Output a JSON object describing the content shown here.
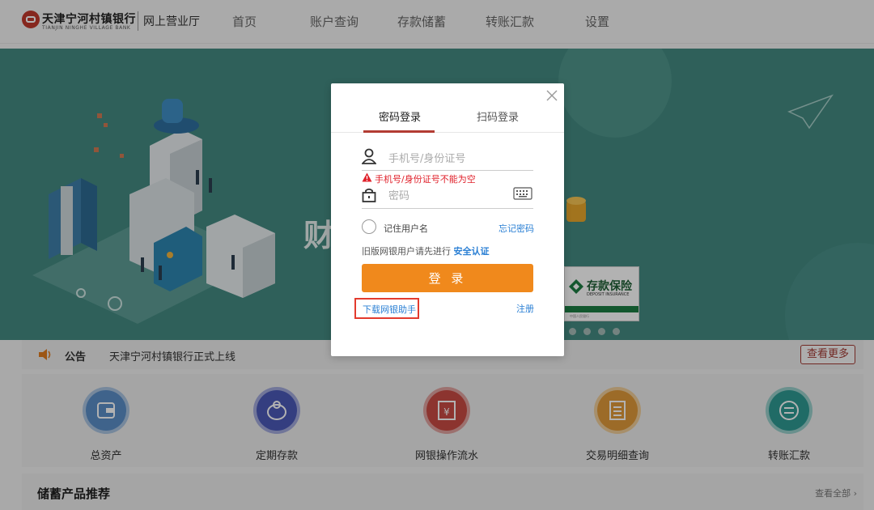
{
  "header": {
    "bank_name": "天津宁河村镇银行",
    "bank_name_en": "TIANJIN NINGHE VILLAGE BANK",
    "subtitle": "网上营业厅",
    "nav": [
      "首页",
      "账户查询",
      "存款储蓄",
      "转账汇款",
      "设置"
    ]
  },
  "banner": {
    "partial_text": "财",
    "insurance_badge": {
      "title": "存款保险",
      "subtitle": "DEPOSIT INSURANCE",
      "fine_print": "中国人民银行"
    },
    "carousel_dots": 4
  },
  "notice": {
    "label": "公告",
    "text": "天津宁河村镇银行正式上线",
    "more_button": "查看更多"
  },
  "services": [
    {
      "label": "总资产",
      "icon": "wallet-icon",
      "color": "#5b8fc8"
    },
    {
      "label": "定期存款",
      "icon": "piggy-bank-icon",
      "color": "#4b59b8"
    },
    {
      "label": "网银操作流水",
      "icon": "yuan-receipt-icon",
      "color": "#c94b44"
    },
    {
      "label": "交易明细查询",
      "icon": "document-list-icon",
      "color": "#e09a3a"
    },
    {
      "label": "转账汇款",
      "icon": "transfer-icon",
      "color": "#2f9a93"
    }
  ],
  "products": {
    "title": "储蓄产品推荐",
    "view_all": "查看全部"
  },
  "login_modal": {
    "tabs": [
      "密码登录",
      "扫码登录"
    ],
    "active_tab": 0,
    "username_placeholder": "手机号/身份证号",
    "username_value": "",
    "error_message": "手机号/身份证号不能为空",
    "password_placeholder": "密码",
    "password_value": "",
    "remember_label": "记住用户名",
    "remember_checked": false,
    "forgot_link": "忘记密码",
    "legacy_text": "旧版网银用户请先进行",
    "legacy_link": "安全认证",
    "login_button": "登 录",
    "download_link": "下载网银助手",
    "register_link": "注册"
  },
  "colors": {
    "banner_bg": "#448a82",
    "accent_red": "#b33c33",
    "login_orange": "#f0891c",
    "link_blue": "#2a7fd4",
    "error_red": "#e0202a"
  }
}
